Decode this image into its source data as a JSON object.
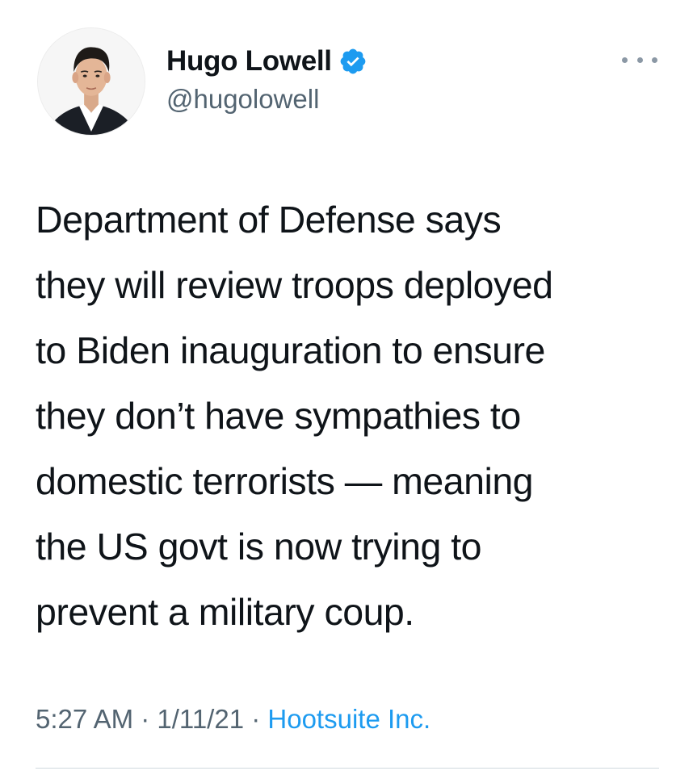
{
  "author": {
    "display_name": "Hugo Lowell",
    "handle": "@hugolowell",
    "verified": true
  },
  "tweet": {
    "lines": [
      "Department of Defense says",
      "they will review troops deployed",
      "to Biden inauguration to ensure",
      "they don’t have sympathies to",
      "domestic terrorists — meaning",
      "the US govt is now trying to",
      "prevent a military coup."
    ],
    "time": "5:27 AM",
    "date": "1/11/21",
    "source": "Hootsuite Inc.",
    "separator": " · "
  },
  "colors": {
    "accent": "#1d9bf0",
    "secondary_text": "#536471",
    "primary_text": "#0f1419"
  },
  "icons": {
    "more": "more-options-icon",
    "verified": "verified-badge-icon"
  }
}
